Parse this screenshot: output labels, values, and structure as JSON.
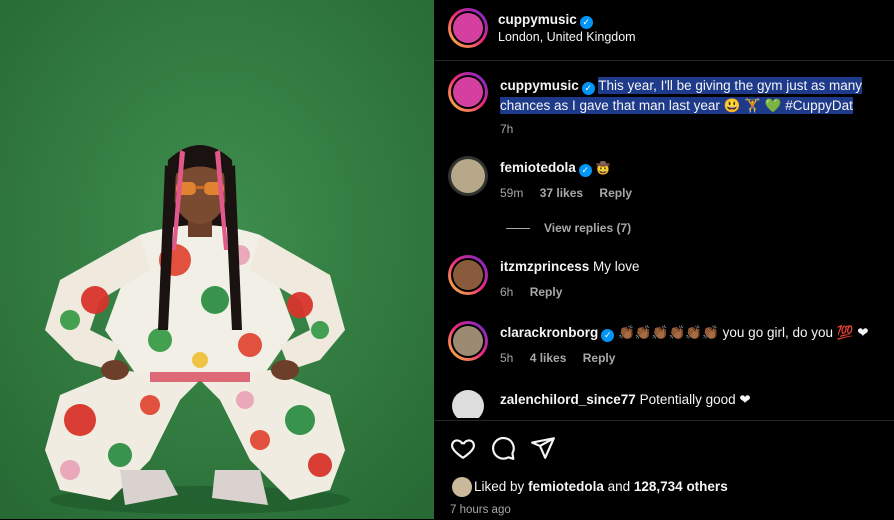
{
  "post": {
    "author": "cuppymusic",
    "location": "London, United Kingdom"
  },
  "caption": {
    "author": "cuppymusic",
    "text": "This year, I'll be giving the gym just as many chances as I gave that man last year 😃 🏋 💚 #CuppyDat",
    "time": "7h"
  },
  "comments": [
    {
      "user": "femiotedola",
      "verified": true,
      "text": "🤠",
      "time": "59m",
      "likes": "37 likes",
      "reply": "Reply"
    },
    {
      "user": "itzmzprincess",
      "verified": false,
      "text": "My love",
      "time": "6h",
      "likes": "",
      "reply": "Reply"
    },
    {
      "user": "clarackronborg",
      "verified": true,
      "text": "👏🏾👏🏾👏🏾👏🏾👏🏾👏🏾 you go girl, do you 💯 ❤",
      "time": "5h",
      "likes": "4 likes",
      "reply": "Reply"
    },
    {
      "user": "zalenchilord_since77",
      "verified": false,
      "text": "Potentially good ❤"
    }
  ],
  "view_replies": "View replies (7)",
  "likes": {
    "prefix": "Liked by",
    "user": "femiotedola",
    "middle": "and",
    "others": "128,734 others"
  },
  "posted_ago": "7 hours ago",
  "icons": [
    "heart-icon",
    "comment-icon",
    "share-icon",
    "verified-icon"
  ],
  "colors": {
    "background": "#000000",
    "verified": "#0095f6",
    "highlight": "#1e3a8a",
    "photo_bg": "#2f7a3f"
  }
}
